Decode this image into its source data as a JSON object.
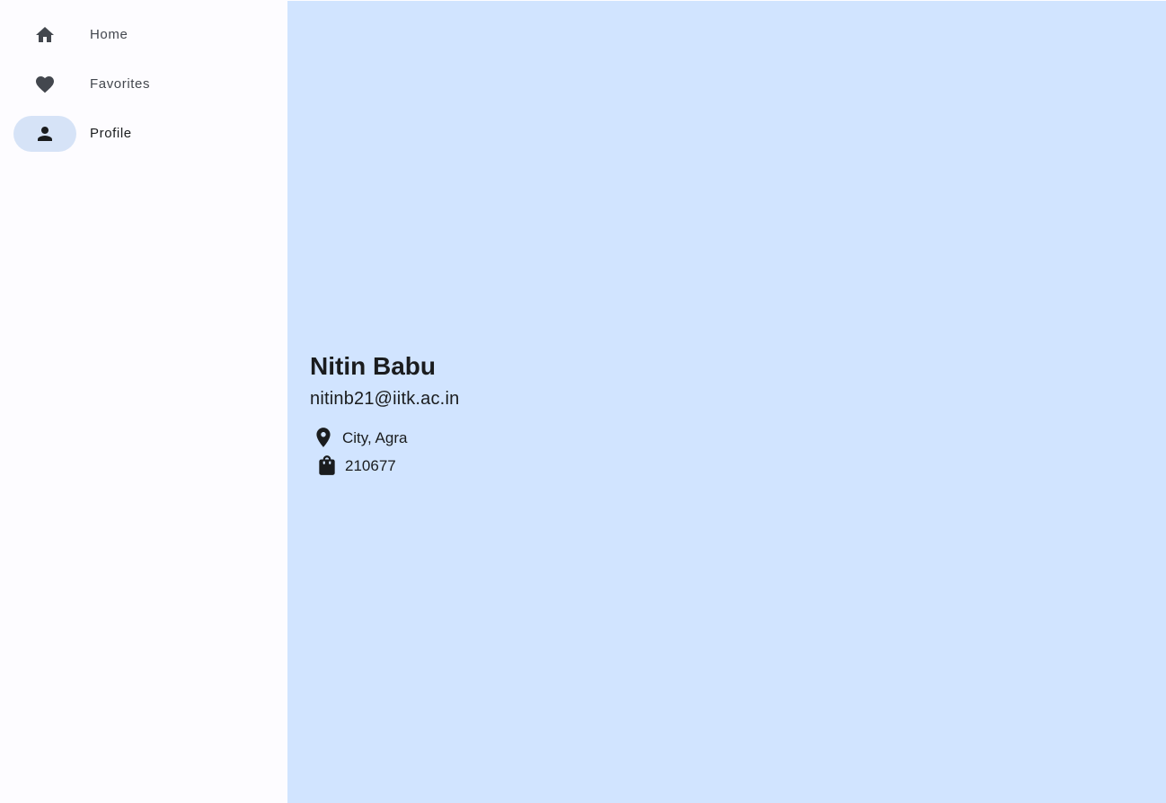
{
  "nav": {
    "items": [
      {
        "label": "Home",
        "icon": "home-icon",
        "selected": false
      },
      {
        "label": "Favorites",
        "icon": "heart-icon",
        "selected": false
      },
      {
        "label": "Profile",
        "icon": "person-icon",
        "selected": true
      }
    ]
  },
  "profile": {
    "name": "Nitin Babu",
    "email": "nitinb21@iitk.ac.in",
    "location": "City, Agra",
    "location_icon": "location-pin-icon",
    "code": "210677",
    "code_icon": "shopping-bag-icon"
  },
  "colors": {
    "rail_background": "#fdfcff",
    "content_background": "#d1e4ff",
    "nav_indicator": "#d6e3f7",
    "icon_color": "#43474e",
    "text_color": "#1a1c1e"
  }
}
